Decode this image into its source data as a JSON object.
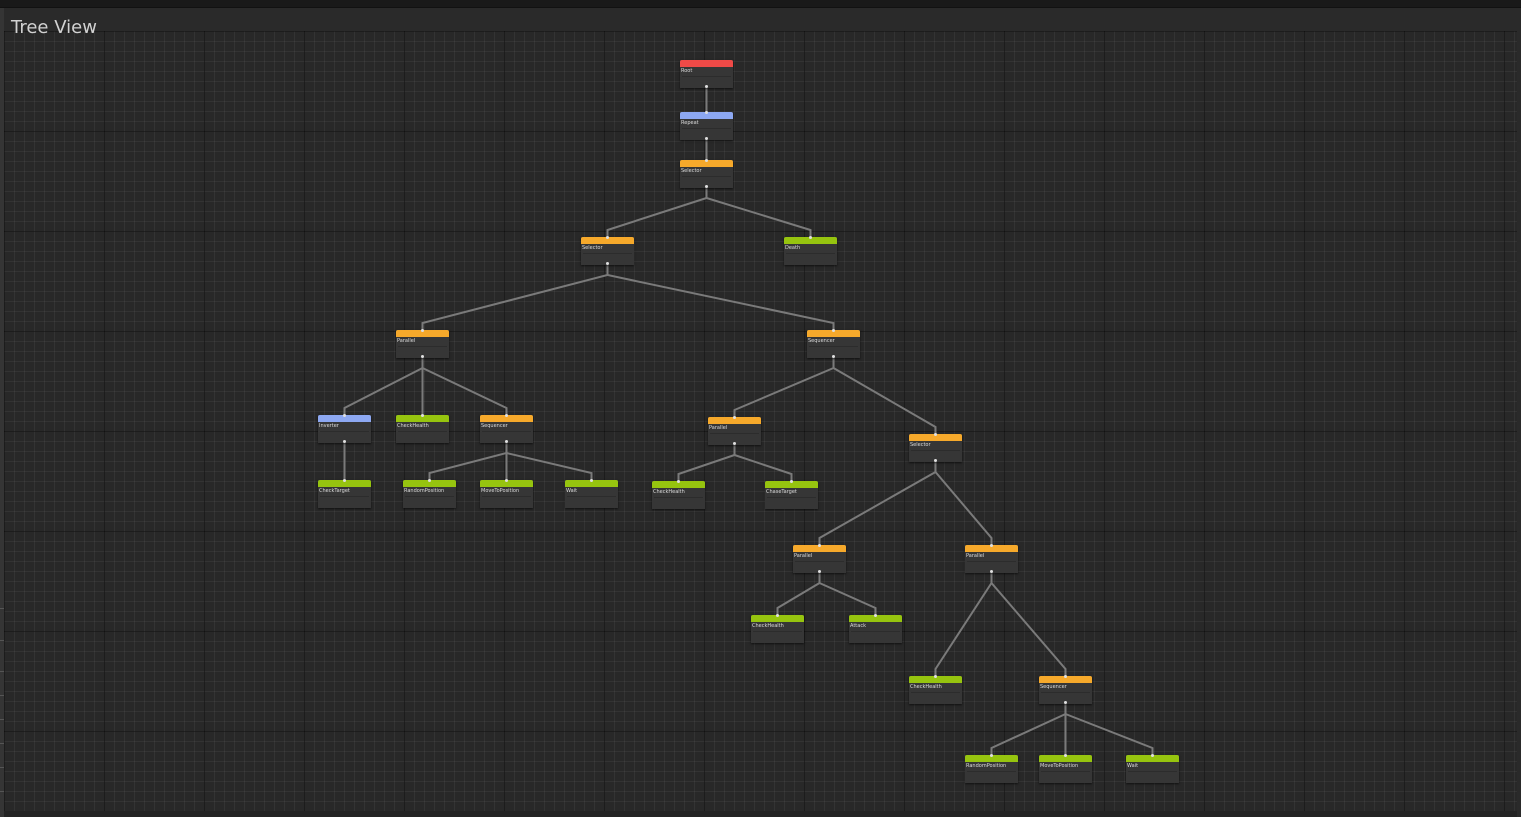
{
  "panel": {
    "title": "Tree View"
  },
  "colors": {
    "root": "#ef4a47",
    "decorator": "#8da8f2",
    "composite": "#f6a92b",
    "action": "#96c40f",
    "edge": "#7a7a7a"
  },
  "nodes": [
    {
      "id": "root",
      "label": "Root",
      "kind": "root"
    },
    {
      "id": "repeat",
      "label": "Repeat",
      "kind": "decorator",
      "parent": "root"
    },
    {
      "id": "selector-main",
      "label": "Selector",
      "kind": "composite",
      "parent": "repeat"
    },
    {
      "id": "selector-a",
      "label": "Selector",
      "kind": "composite",
      "parent": "selector-main"
    },
    {
      "id": "death",
      "label": "Death",
      "kind": "action",
      "parent": "selector-main"
    },
    {
      "id": "parallel-a",
      "label": "Parallel",
      "kind": "composite",
      "parent": "selector-a"
    },
    {
      "id": "sequencer-b",
      "label": "Sequencer",
      "kind": "composite",
      "parent": "selector-a"
    },
    {
      "id": "inverter",
      "label": "Inverter",
      "kind": "decorator",
      "parent": "parallel-a"
    },
    {
      "id": "checkhealth-1",
      "label": "CheckHealth",
      "kind": "action",
      "parent": "parallel-a"
    },
    {
      "id": "sequencer-a",
      "label": "Sequencer",
      "kind": "composite",
      "parent": "parallel-a"
    },
    {
      "id": "checktarget",
      "label": "CheckTarget",
      "kind": "action",
      "parent": "inverter"
    },
    {
      "id": "randompos-1",
      "label": "RandomPosition",
      "kind": "action",
      "parent": "sequencer-a"
    },
    {
      "id": "movetopos-1",
      "label": "MoveToPosition",
      "kind": "action",
      "parent": "sequencer-a"
    },
    {
      "id": "wait-1",
      "label": "Wait",
      "kind": "action",
      "parent": "sequencer-a"
    },
    {
      "id": "parallel-b",
      "label": "Parallel",
      "kind": "composite",
      "parent": "sequencer-b"
    },
    {
      "id": "selector-b",
      "label": "Selector",
      "kind": "composite",
      "parent": "sequencer-b"
    },
    {
      "id": "checkhealth-2",
      "label": "CheckHealth",
      "kind": "action",
      "parent": "parallel-b"
    },
    {
      "id": "chasetarget",
      "label": "ChaseTarget",
      "kind": "action",
      "parent": "parallel-b"
    },
    {
      "id": "parallel-c",
      "label": "Parallel",
      "kind": "composite",
      "parent": "selector-b"
    },
    {
      "id": "parallel-d",
      "label": "Parallel",
      "kind": "composite",
      "parent": "selector-b"
    },
    {
      "id": "checkhealth-3",
      "label": "CheckHealth",
      "kind": "action",
      "parent": "parallel-c"
    },
    {
      "id": "attack",
      "label": "Attack",
      "kind": "action",
      "parent": "parallel-c"
    },
    {
      "id": "checkhealth-4",
      "label": "CheckHealth",
      "kind": "action",
      "parent": "parallel-d"
    },
    {
      "id": "sequencer-c",
      "label": "Sequencer",
      "kind": "composite",
      "parent": "parallel-d"
    },
    {
      "id": "randompos-2",
      "label": "RandomPosition",
      "kind": "action",
      "parent": "sequencer-c"
    },
    {
      "id": "movetopos-2",
      "label": "MoveToPosition",
      "kind": "action",
      "parent": "sequencer-c"
    },
    {
      "id": "wait-2",
      "label": "Wait",
      "kind": "action",
      "parent": "sequencer-c"
    }
  ]
}
